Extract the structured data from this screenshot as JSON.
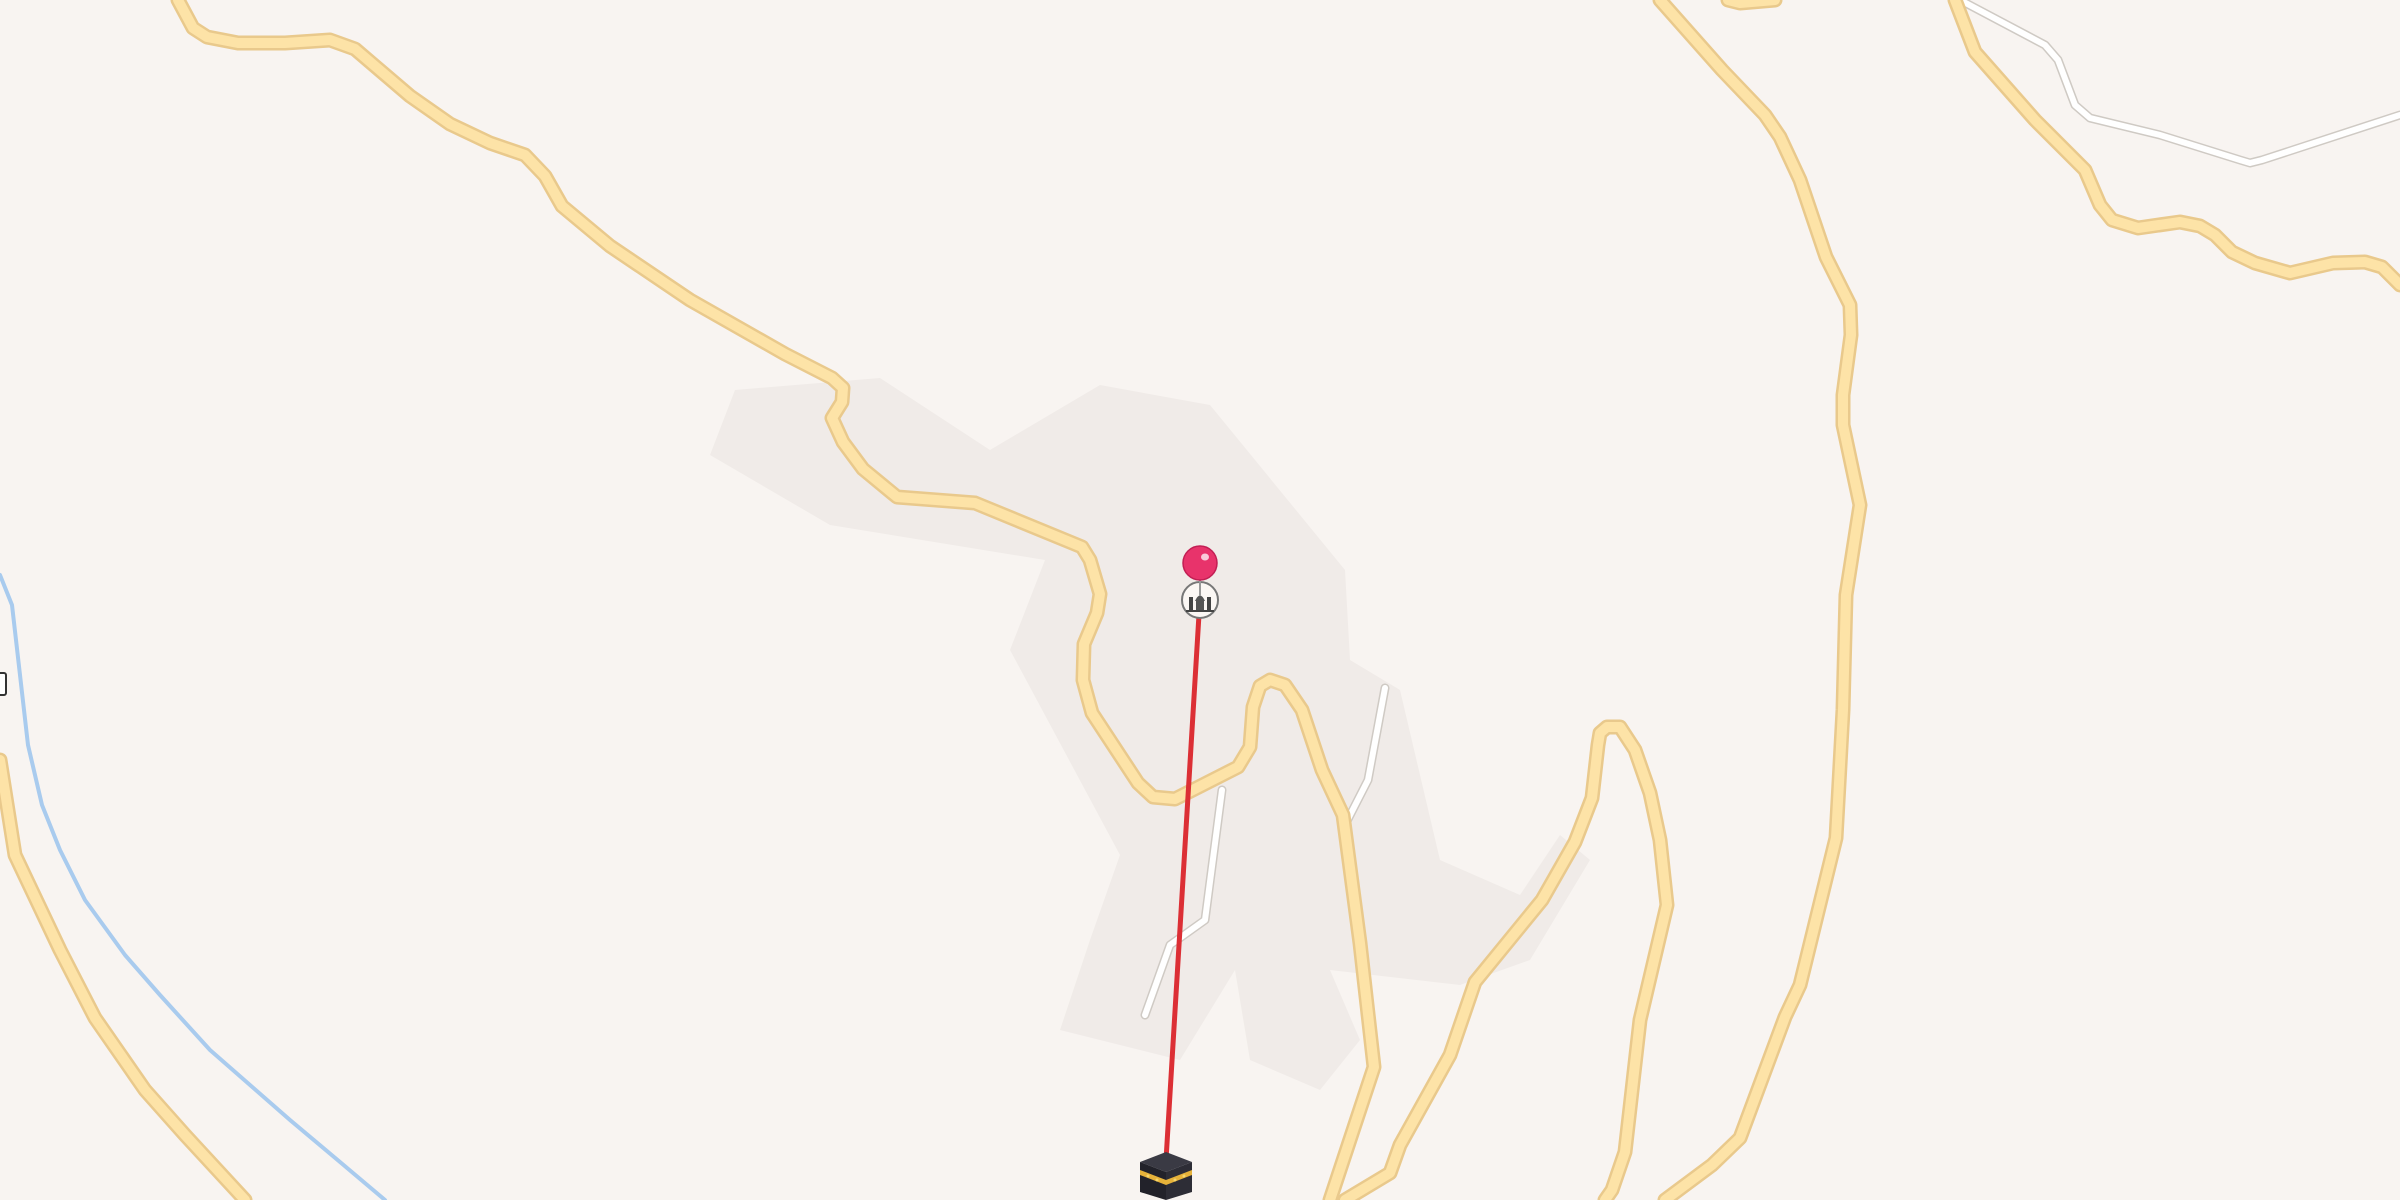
{
  "map": {
    "colors": {
      "land": "#f8f4f1",
      "landuse_patch": "#f0ebe8",
      "major_road": "#fde3a7",
      "major_road_casing": "#e9c98c",
      "minor_path": "#ffffff",
      "waterway": "#a9cbee",
      "qibla_line": "#dc2f35",
      "location_pin": "#e8336b"
    },
    "markers": {
      "location_pin_icon": "red-pushpin",
      "place_icon": "mosque-icon",
      "kaaba_icon": "kaaba-icon"
    },
    "overlay": {
      "line": "qibla-direction-line"
    }
  }
}
